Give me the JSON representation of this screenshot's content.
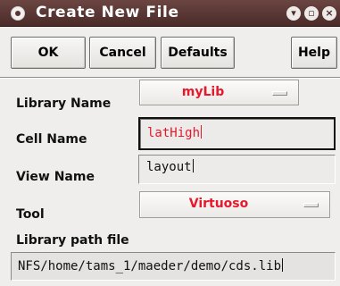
{
  "window": {
    "title": "Create New File",
    "controls": [
      "minimize-icon",
      "maximize-icon",
      "close-icon"
    ]
  },
  "buttons": {
    "ok": "OK",
    "cancel": "Cancel",
    "defaults": "Defaults",
    "help": "Help"
  },
  "form": {
    "library_name": {
      "label": "Library Name",
      "value": "myLib"
    },
    "cell_name": {
      "label": "Cell Name",
      "value": "latHigh"
    },
    "view_name": {
      "label": "View Name",
      "value": "layout"
    },
    "tool": {
      "label": "Tool",
      "value": "Virtuoso"
    },
    "library_path": {
      "label": "Library path file",
      "value": "NFS/home/tams_1/maeder/demo/cds.lib"
    }
  },
  "colors": {
    "titlebar": "#5a3431",
    "accent_text": "#e8182c",
    "background": "#efeeec"
  }
}
